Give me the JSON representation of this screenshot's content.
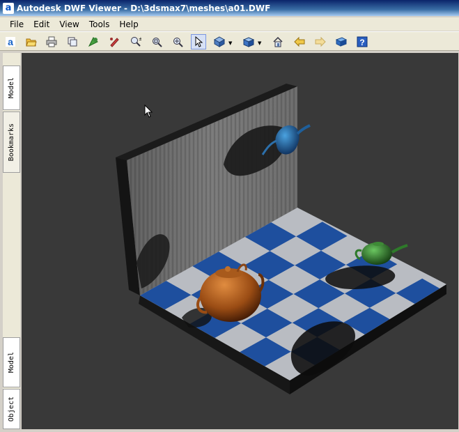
{
  "window": {
    "title": "Autodesk DWF Viewer - D:\\3dsmax7\\meshes\\a01.DWF",
    "app_icon_letter": "a"
  },
  "menu": {
    "items": [
      {
        "label": "File"
      },
      {
        "label": "Edit"
      },
      {
        "label": "View"
      },
      {
        "label": "Tools"
      },
      {
        "label": "Help"
      }
    ]
  },
  "toolbar": {
    "buttons": [
      {
        "icon": "autodesk-logo-icon"
      },
      {
        "icon": "open-folder-icon"
      },
      {
        "icon": "print-icon"
      },
      {
        "icon": "copy-icon"
      },
      {
        "icon": "publish-icon"
      },
      {
        "icon": "markup-icon"
      },
      {
        "icon": "zoom-realtime-icon"
      },
      {
        "icon": "zoom-rectangle-icon"
      },
      {
        "icon": "zoom-fit-icon"
      },
      {
        "icon": "select-arrow-icon",
        "active": true
      },
      {
        "icon": "orbit-icon"
      },
      {
        "icon": "cube-view-icon"
      },
      {
        "icon": "home-icon"
      },
      {
        "icon": "back-arrow-icon"
      },
      {
        "icon": "forward-arrow-icon"
      },
      {
        "icon": "box-icon"
      },
      {
        "icon": "help-icon"
      }
    ]
  },
  "sidebar": {
    "top_tabs": [
      {
        "label": "Model"
      },
      {
        "label": "Bookmarks"
      }
    ],
    "bottom_tabs": [
      {
        "label": "Model"
      },
      {
        "label": "Object"
      }
    ]
  },
  "scene": {
    "teapots": [
      {
        "name": "blue",
        "color": "#1f5f9a"
      },
      {
        "name": "green",
        "color": "#2e7a2a"
      },
      {
        "name": "orange",
        "color": "#b5601c"
      }
    ],
    "floor_colors": {
      "light": "#b9bcc2",
      "dark": "#1e4f9e"
    },
    "background": "#393939"
  }
}
